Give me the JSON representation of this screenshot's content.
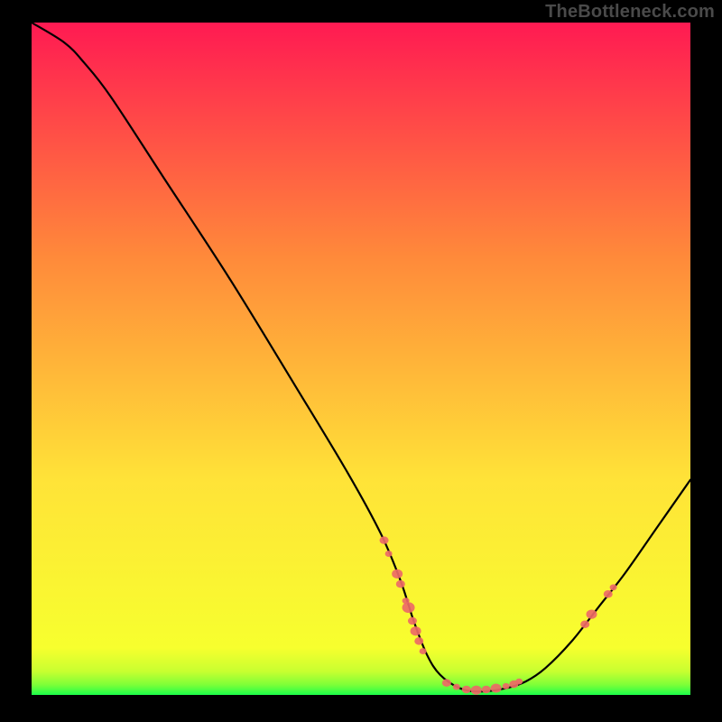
{
  "watermark": "TheBottleneck.com",
  "chart_data": {
    "type": "line",
    "title": "",
    "xlabel": "",
    "ylabel": "",
    "xlim": [
      0,
      100
    ],
    "ylim": [
      0,
      100
    ],
    "curve": [
      {
        "x": 0,
        "y": 100
      },
      {
        "x": 5,
        "y": 97
      },
      {
        "x": 8,
        "y": 94
      },
      {
        "x": 12,
        "y": 89
      },
      {
        "x": 20,
        "y": 77
      },
      {
        "x": 30,
        "y": 62
      },
      {
        "x": 40,
        "y": 46
      },
      {
        "x": 48,
        "y": 33
      },
      {
        "x": 53,
        "y": 24
      },
      {
        "x": 56,
        "y": 17
      },
      {
        "x": 58,
        "y": 11
      },
      {
        "x": 60,
        "y": 6
      },
      {
        "x": 62,
        "y": 3
      },
      {
        "x": 65,
        "y": 1
      },
      {
        "x": 68,
        "y": 0.5
      },
      {
        "x": 72,
        "y": 1
      },
      {
        "x": 75,
        "y": 2
      },
      {
        "x": 78,
        "y": 4
      },
      {
        "x": 82,
        "y": 8
      },
      {
        "x": 86,
        "y": 13
      },
      {
        "x": 90,
        "y": 18
      },
      {
        "x": 95,
        "y": 25
      },
      {
        "x": 100,
        "y": 32
      }
    ],
    "markers": [
      {
        "x": 53.5,
        "y": 23,
        "size": 5
      },
      {
        "x": 54.2,
        "y": 21,
        "size": 4
      },
      {
        "x": 55.5,
        "y": 18,
        "size": 6
      },
      {
        "x": 56.0,
        "y": 16.5,
        "size": 5
      },
      {
        "x": 56.8,
        "y": 14,
        "size": 4
      },
      {
        "x": 57.2,
        "y": 13,
        "size": 7
      },
      {
        "x": 57.8,
        "y": 11,
        "size": 5
      },
      {
        "x": 58.3,
        "y": 9.5,
        "size": 6
      },
      {
        "x": 58.8,
        "y": 8,
        "size": 5
      },
      {
        "x": 59.4,
        "y": 6.5,
        "size": 4
      },
      {
        "x": 63.0,
        "y": 1.8,
        "size": 5
      },
      {
        "x": 64.5,
        "y": 1.2,
        "size": 4
      },
      {
        "x": 66.0,
        "y": 0.8,
        "size": 5
      },
      {
        "x": 67.5,
        "y": 0.7,
        "size": 6
      },
      {
        "x": 69.0,
        "y": 0.8,
        "size": 5
      },
      {
        "x": 70.5,
        "y": 1.0,
        "size": 6
      },
      {
        "x": 72.0,
        "y": 1.3,
        "size": 4
      },
      {
        "x": 73.2,
        "y": 1.6,
        "size": 5
      },
      {
        "x": 74.0,
        "y": 2.0,
        "size": 4
      },
      {
        "x": 84.0,
        "y": 10.5,
        "size": 5
      },
      {
        "x": 85.0,
        "y": 12,
        "size": 6
      },
      {
        "x": 87.5,
        "y": 15,
        "size": 5
      },
      {
        "x": 88.3,
        "y": 16,
        "size": 4
      }
    ],
    "colors": {
      "curve": "#000000",
      "marker": "#ed6a66",
      "grad_top": "#ff1a52",
      "grad_mid1": "#ff8a3a",
      "grad_mid2": "#ffe338",
      "grad_low": "#f7ff2e",
      "grad_bottom": "#1cff4a"
    }
  }
}
